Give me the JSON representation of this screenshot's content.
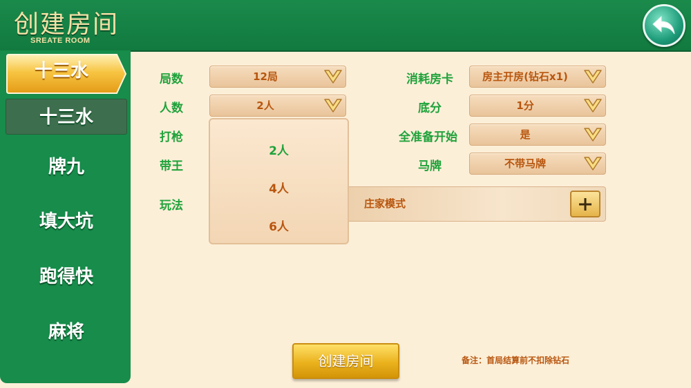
{
  "header": {
    "title": "创建房间",
    "subtitle": "SREATE ROOM",
    "back_icon": "back-arrow-icon"
  },
  "sidebar": {
    "active_tab": "十三水",
    "items": [
      {
        "label": "十三水",
        "selected": true
      },
      {
        "label": "牌九"
      },
      {
        "label": "填大坑"
      },
      {
        "label": "跑得快"
      },
      {
        "label": "麻将"
      }
    ]
  },
  "form": {
    "rounds": {
      "label": "局数",
      "value": "12局"
    },
    "players": {
      "label": "人数",
      "value": "2人"
    },
    "gun": {
      "label": "打枪"
    },
    "joker": {
      "label": "带王"
    },
    "mode": {
      "label": "玩法",
      "value": "庄家模式"
    },
    "room_card": {
      "label": "消耗房卡",
      "value": "房主开房(钻石x1)"
    },
    "base_score": {
      "label": "底分",
      "value": "1分"
    },
    "all_ready": {
      "label": "全准备开始",
      "value": "是"
    },
    "horse": {
      "label": "马牌",
      "value": "不带马牌"
    }
  },
  "popup": {
    "options": [
      "2人",
      "4人",
      "6人"
    ],
    "selected": "2人"
  },
  "create_button": "创建房间",
  "note": "备注：首局结算前不扣除钻石",
  "colors": {
    "header_green": "#1a8a4b",
    "label_green": "#1fa23b",
    "value_orange": "#b8560f",
    "background": "#fcefd8",
    "gold": "#eab21d"
  }
}
